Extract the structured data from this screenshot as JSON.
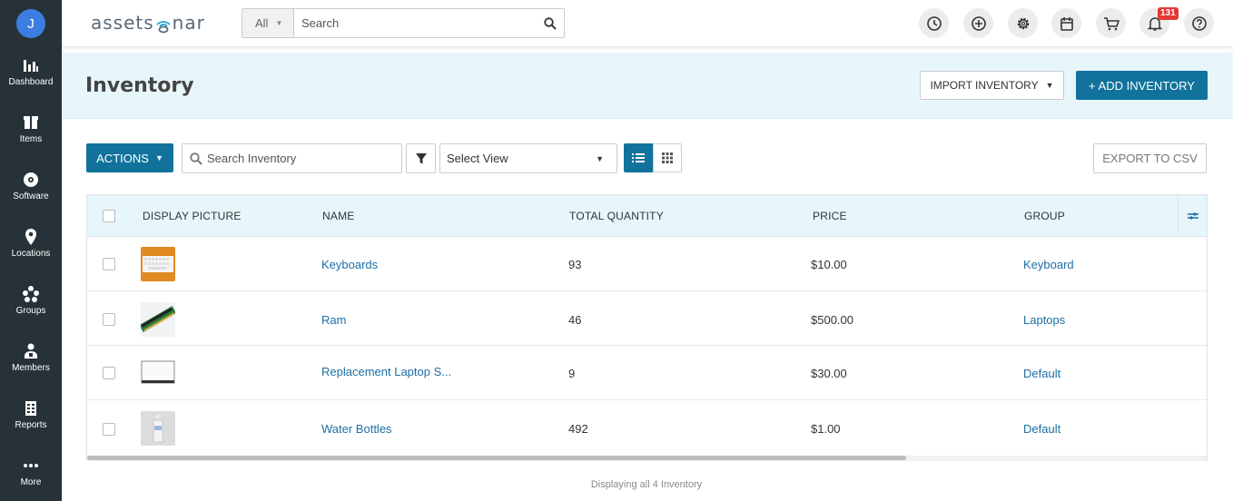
{
  "user": {
    "avatar_initial": "J"
  },
  "sidebar": {
    "items": [
      {
        "label": "Dashboard",
        "icon": "dashboard-icon"
      },
      {
        "label": "Items",
        "icon": "items-icon"
      },
      {
        "label": "Software",
        "icon": "software-icon"
      },
      {
        "label": "Locations",
        "icon": "location-pin-icon"
      },
      {
        "label": "Groups",
        "icon": "groups-icon"
      },
      {
        "label": "Members",
        "icon": "members-icon"
      },
      {
        "label": "Reports",
        "icon": "reports-icon"
      },
      {
        "label": "More",
        "icon": "more-dots-icon"
      }
    ]
  },
  "header": {
    "logo_text_left": "assets",
    "logo_text_right": "nar",
    "search_scope": "All",
    "search_placeholder": "Search",
    "notification_count": "131",
    "icons": [
      "history-icon",
      "add-circle-icon",
      "settings-gear-icon",
      "calendar-icon",
      "cart-icon",
      "bell-icon",
      "help-icon"
    ]
  },
  "page": {
    "title": "Inventory",
    "import_label": "IMPORT INVENTORY",
    "add_label": "+ ADD INVENTORY"
  },
  "toolbar": {
    "actions_label": "ACTIONS",
    "search_placeholder": "Search Inventory",
    "view_select": "Select View",
    "export_label": "EXPORT TO CSV"
  },
  "table": {
    "columns": [
      "DISPLAY PICTURE",
      "NAME",
      "TOTAL QUANTITY",
      "PRICE",
      "GROUP"
    ],
    "rows": [
      {
        "name": "Keyboards",
        "quantity": "93",
        "price": "$10.00",
        "group": "Keyboard",
        "picture": "keyboard-thumbnail"
      },
      {
        "name": "Ram",
        "quantity": "46",
        "price": "$500.00",
        "group": "Laptops",
        "picture": "ram-thumbnail"
      },
      {
        "name": "Replacement Laptop S...",
        "quantity": "9",
        "price": "$30.00",
        "group": "Default",
        "picture": "laptop-screen-thumbnail"
      },
      {
        "name": "Water Bottles",
        "quantity": "492",
        "price": "$1.00",
        "group": "Default",
        "picture": "water-bottle-thumbnail"
      }
    ],
    "footer": "Displaying all 4 Inventory"
  },
  "colors": {
    "sidebar": "#263238",
    "primary": "#11739c",
    "band": "#e6f6fa",
    "link": "#1d6fa5",
    "badge": "#e53935"
  }
}
